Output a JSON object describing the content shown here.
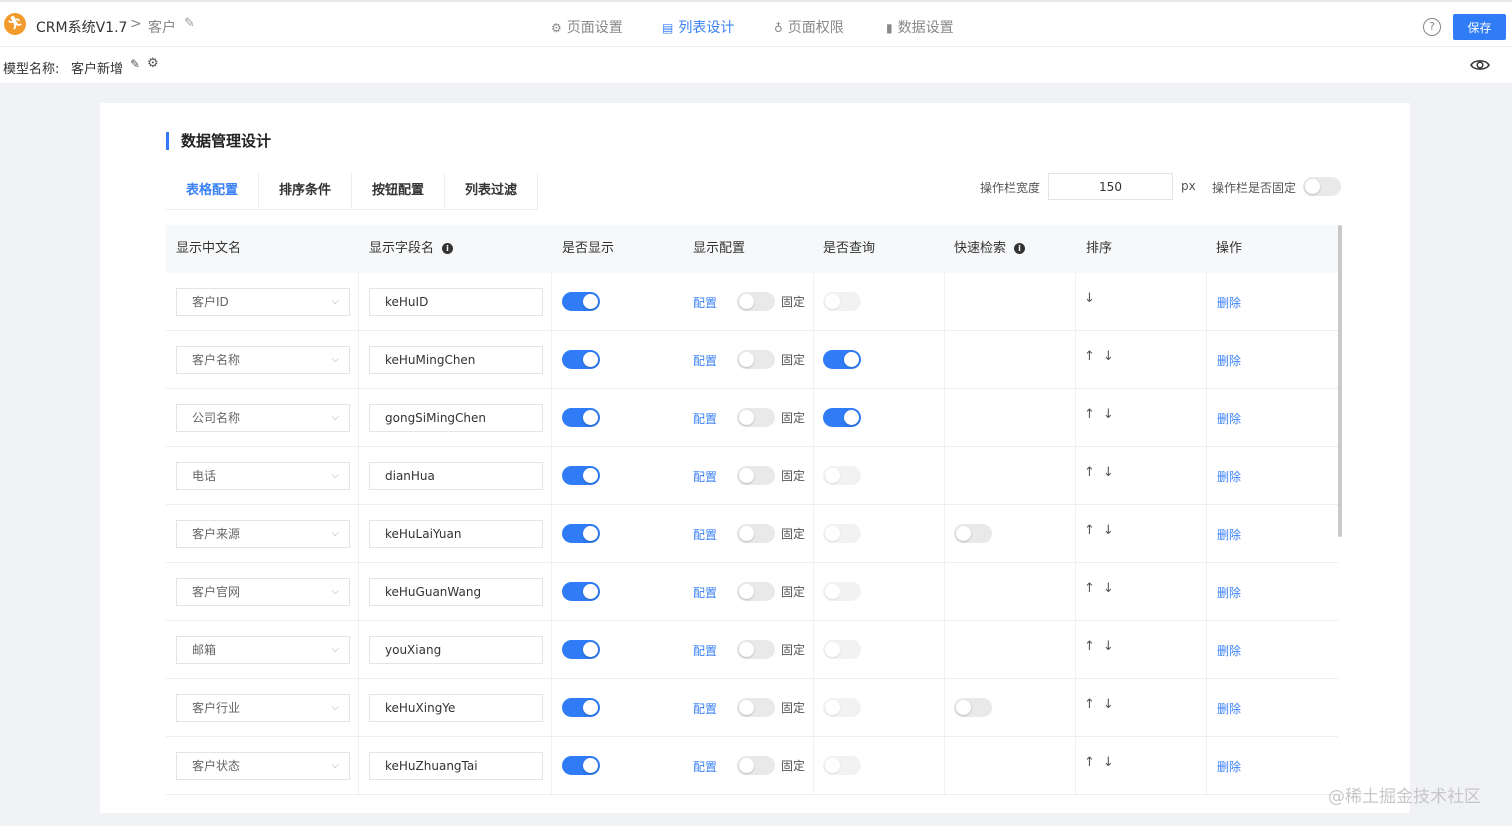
{
  "app": {
    "title": "CRM系统V1.7",
    "breadcrumb_sep": ">",
    "breadcrumb_page": "客户",
    "logo_icon": "person-run-icon"
  },
  "nav_tabs": [
    {
      "label": "页面设置",
      "icon": "gear-icon",
      "active": false
    },
    {
      "label": "列表设计",
      "icon": "list-design-icon",
      "active": true
    },
    {
      "label": "页面权限",
      "icon": "lock-icon",
      "active": false
    },
    {
      "label": "数据设置",
      "icon": "bar-chart-icon",
      "active": false
    }
  ],
  "toolbar": {
    "save_label": "保存",
    "help_label": "?"
  },
  "model": {
    "label": "模型名称:",
    "value": "客户新增"
  },
  "section": {
    "title": "数据管理设计"
  },
  "sub_tabs": [
    {
      "label": "表格配置",
      "active": true
    },
    {
      "label": "排序条件",
      "active": false
    },
    {
      "label": "按钮配置",
      "active": false
    },
    {
      "label": "列表过滤",
      "active": false
    }
  ],
  "op_settings": {
    "width_label": "操作栏宽度",
    "width_value": "150",
    "width_unit": "px",
    "fixed_label": "操作栏是否固定",
    "fixed_on": false
  },
  "table": {
    "columns": [
      "显示中文名",
      "显示字段名",
      "是否显示",
      "显示配置",
      "是否查询",
      "快速检索",
      "排序",
      "操作"
    ],
    "config_link": "配置",
    "fixed_label": "固定",
    "delete_link": "删除",
    "up_arrow": "↑",
    "down_arrow": "↓",
    "rows": [
      {
        "cn_name": "客户ID",
        "field": "keHuID",
        "show": true,
        "fixed": false,
        "query": false,
        "quick": null,
        "up": false,
        "down": true
      },
      {
        "cn_name": "客户名称",
        "field": "keHuMingChen",
        "show": true,
        "fixed": false,
        "query": true,
        "quick": null,
        "up": true,
        "down": true
      },
      {
        "cn_name": "公司名称",
        "field": "gongSiMingChen",
        "show": true,
        "fixed": false,
        "query": true,
        "quick": null,
        "up": true,
        "down": true
      },
      {
        "cn_name": "电话",
        "field": "dianHua",
        "show": true,
        "fixed": false,
        "query": false,
        "quick": null,
        "up": true,
        "down": true
      },
      {
        "cn_name": "客户来源",
        "field": "keHuLaiYuan",
        "show": true,
        "fixed": false,
        "query": false,
        "quick": false,
        "up": true,
        "down": true
      },
      {
        "cn_name": "客户官网",
        "field": "keHuGuanWang",
        "show": true,
        "fixed": false,
        "query": false,
        "quick": null,
        "up": true,
        "down": true
      },
      {
        "cn_name": "邮箱",
        "field": "youXiang",
        "show": true,
        "fixed": false,
        "query": false,
        "quick": null,
        "up": true,
        "down": true
      },
      {
        "cn_name": "客户行业",
        "field": "keHuXingYe",
        "show": true,
        "fixed": false,
        "query": false,
        "quick": false,
        "up": true,
        "down": true
      },
      {
        "cn_name": "客户状态",
        "field": "keHuZhuangTai",
        "show": true,
        "fixed": false,
        "query": false,
        "quick": null,
        "up": true,
        "down": true
      }
    ]
  },
  "brand_watermark": "@稀土掘金技术社区",
  "colors": {
    "accent": "#2f7cf6",
    "logo": "#f39a2d"
  }
}
